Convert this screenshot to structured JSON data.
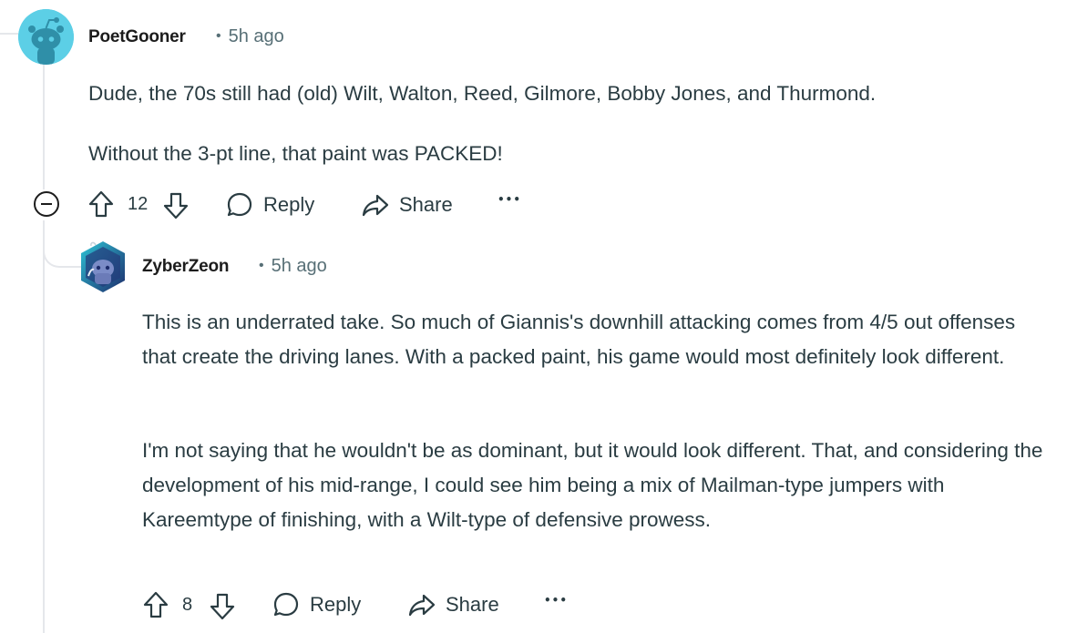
{
  "comments": [
    {
      "username": "PoetGooner",
      "dot": "•",
      "time": "5h ago",
      "paragraphs": [
        "Dude, the 70s still had (old) Wilt, Walton, Reed, Gilmore, Bobby Jones, and Thurmond.",
        "Without the 3-pt line, that paint was PACKED!"
      ],
      "votes": "12",
      "reply_label": "Reply",
      "share_label": "Share",
      "more_label": "•••"
    },
    {
      "username": "ZyberZeon",
      "dot": "•",
      "time": "5h ago",
      "paragraphs": [
        "This is an underrated take. So much of Giannis's downhill attacking comes from 4/5 out offenses that create the driving lanes. With a packed paint, his game would most definitely look different.",
        "I'm not saying that he wouldn't be as dominant, but it would look different. That, and considering the development of his mid-range, I could see him being a mix of Mailman-type jumpers with Kareemtype of finishing, with a Wilt-type of defensive prowess."
      ],
      "votes": "8",
      "reply_label": "Reply",
      "share_label": "Share",
      "more_label": "•••"
    }
  ],
  "icons": {
    "collapse": "collapse-icon",
    "upvote": "upvote-icon",
    "downvote": "downvote-icon",
    "reply": "speech-bubble-icon",
    "share": "share-arrow-icon",
    "more": "more-icon"
  },
  "colors": {
    "avatar_snoo_bg": "#5ccfe6",
    "avatar_snoo_body": "#2f8fa8",
    "thread_line": "#e5e7eb",
    "meta_text": "#576f76"
  }
}
